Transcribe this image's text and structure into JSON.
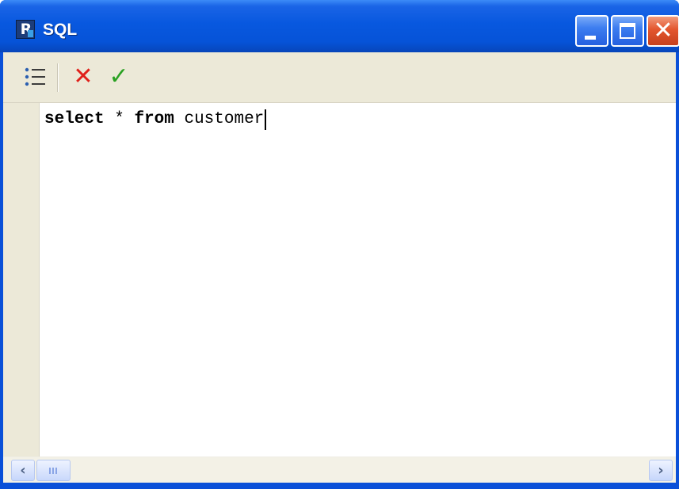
{
  "window": {
    "title": "SQL",
    "app_icon": "fast-report-icon",
    "controls": {
      "minimize": "minimize-icon",
      "maximize": "maximize-icon",
      "close": "close-icon",
      "close_glyph": "✕"
    }
  },
  "toolbar": {
    "items": [
      {
        "name": "params",
        "icon": "list-icon"
      },
      {
        "name": "cancel",
        "icon": "cancel-x-icon",
        "glyph": "✕"
      },
      {
        "name": "ok",
        "icon": "checkmark-icon",
        "glyph": "✓"
      }
    ]
  },
  "editor": {
    "tokens": {
      "kw_select": "select",
      "star": " * ",
      "kw_from": "from",
      "table": " customer"
    }
  },
  "scrollbar": {
    "left_arrow": "‹",
    "right_arrow": "›"
  },
  "colors": {
    "titlebar": "#0858df",
    "toolbar": "#ece9d8",
    "cancel": "#e0201a",
    "ok": "#2aa122"
  }
}
